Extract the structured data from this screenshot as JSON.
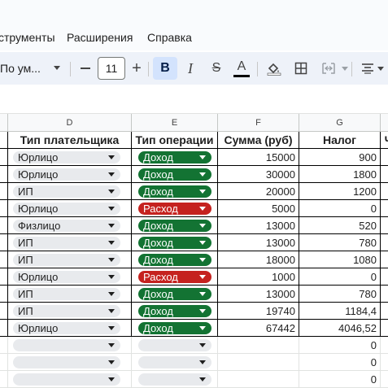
{
  "menu": {
    "items": [
      "струменты",
      "Расширения",
      "Справка"
    ]
  },
  "toolbar": {
    "font_name": "По ум...",
    "font_size": "11",
    "bold_label": "B",
    "italic_label": "I",
    "strike_label": "S",
    "text_color_label": "A",
    "icons": [
      "minus-icon",
      "plus-icon",
      "bold-icon",
      "italic-icon",
      "strikethrough-icon",
      "text-color-icon",
      "fill-color-icon",
      "borders-icon",
      "merge-cells-icon",
      "align-icon"
    ]
  },
  "sheet": {
    "columns": [
      "D",
      "E",
      "F",
      "G"
    ],
    "headers": [
      "Тип плательщика",
      "Тип операции",
      "Сумма (руб)",
      "Налог",
      "Ч"
    ],
    "rows": [
      {
        "payer": "Юрлицо",
        "op": "Доход",
        "op_type": "income",
        "sum": "15000",
        "tax": "900"
      },
      {
        "payer": "Юрлицо",
        "op": "Доход",
        "op_type": "income",
        "sum": "30000",
        "tax": "1800"
      },
      {
        "payer": "ИП",
        "op": "Доход",
        "op_type": "income",
        "sum": "20000",
        "tax": "1200"
      },
      {
        "payer": "Юрлицо",
        "op": "Расход",
        "op_type": "expense",
        "sum": "5000",
        "tax": "0"
      },
      {
        "payer": "Физлицо",
        "op": "Доход",
        "op_type": "income",
        "sum": "13000",
        "tax": "520"
      },
      {
        "payer": "ИП",
        "op": "Доход",
        "op_type": "income",
        "sum": "13000",
        "tax": "780"
      },
      {
        "payer": "ИП",
        "op": "Доход",
        "op_type": "income",
        "sum": "18000",
        "tax": "1080"
      },
      {
        "payer": "Юрлицо",
        "op": "Расход",
        "op_type": "expense",
        "sum": "1000",
        "tax": "0"
      },
      {
        "payer": "ИП",
        "op": "Доход",
        "op_type": "income",
        "sum": "13000",
        "tax": "780"
      },
      {
        "payer": "ИП",
        "op": "Доход",
        "op_type": "income",
        "sum": "19740",
        "tax": "1184,4"
      },
      {
        "payer": "Юрлицо",
        "op": "Доход",
        "op_type": "income",
        "sum": "67442",
        "tax": "4046,52"
      },
      {
        "payer": "",
        "op": "",
        "op_type": "empty",
        "sum": "",
        "tax": "0"
      },
      {
        "payer": "",
        "op": "",
        "op_type": "empty",
        "sum": "",
        "tax": "0"
      },
      {
        "payer": "",
        "op": "",
        "op_type": "empty",
        "sum": "",
        "tax": "0"
      }
    ]
  },
  "colors": {
    "income_chip": "#137333",
    "expense_chip": "#c5221f",
    "payer_chip": "#e8eaed",
    "bold_active": "#d3e3fd"
  }
}
